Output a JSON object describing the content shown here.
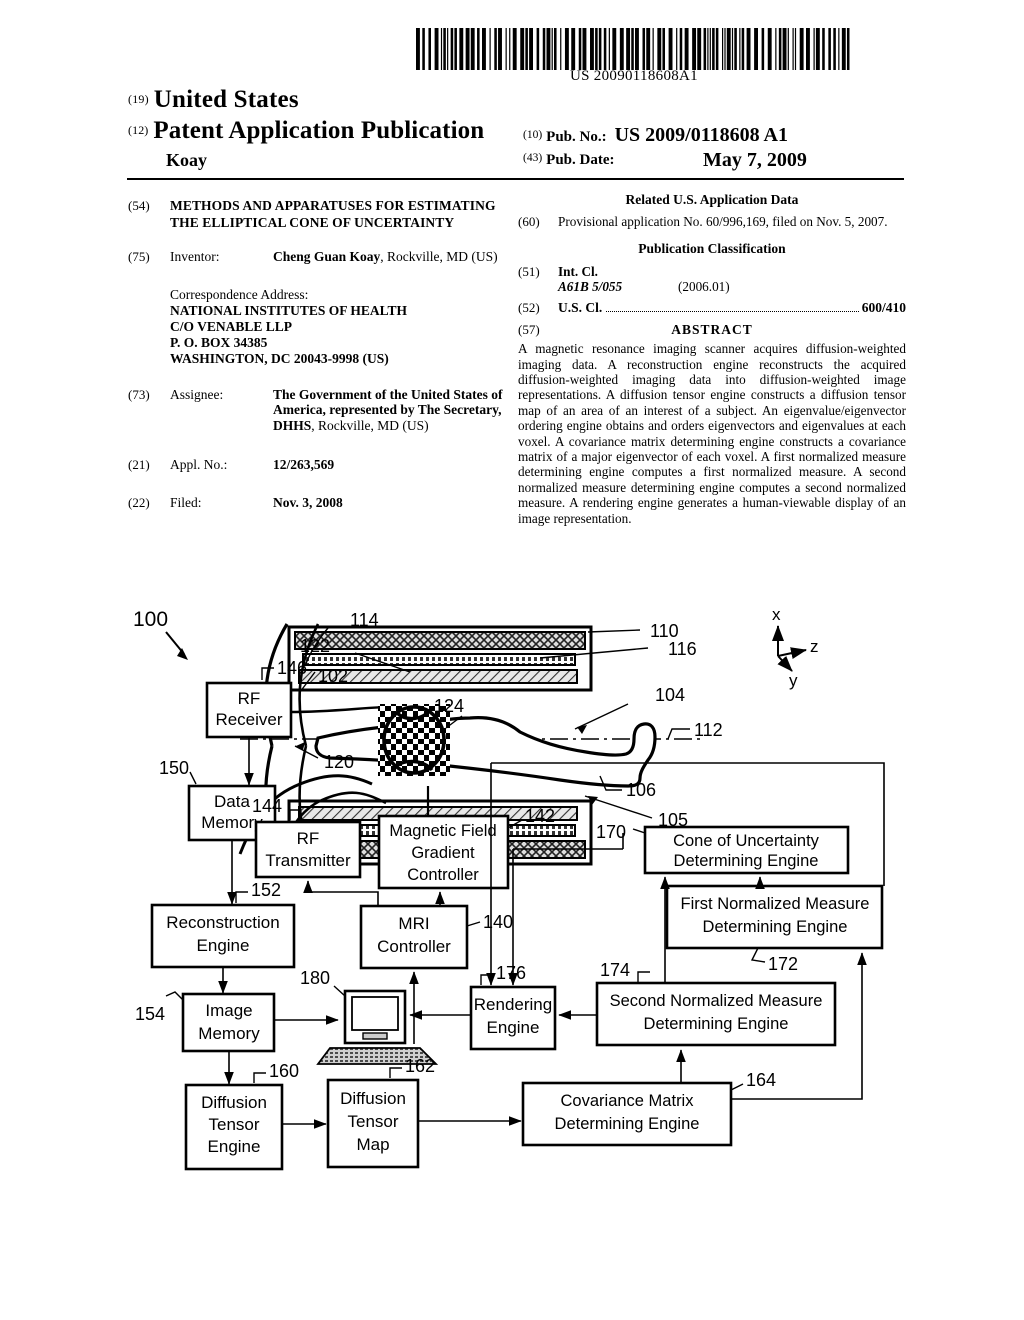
{
  "header": {
    "barcode_text": "US 20090118608A1",
    "country_code_num": "(19)",
    "country": "United States",
    "doc_type_num": "(12)",
    "doc_type": "Patent Application Publication",
    "inventor_surname": "Koay",
    "pub_no_num": "(10)",
    "pub_no_label": "Pub. No.:",
    "pub_no_value": "US 2009/0118608 A1",
    "pub_date_num": "(43)",
    "pub_date_label": "Pub. Date:",
    "pub_date_value": "May 7, 2009"
  },
  "left_column": {
    "title_num": "(54)",
    "title": "METHODS AND APPARATUSES FOR ESTIMATING THE ELLIPTICAL CONE OF UNCERTAINTY",
    "inventor_num": "(75)",
    "inventor_label": "Inventor:",
    "inventor_name": "Cheng Guan Koay",
    "inventor_location": ", Rockville, MD (US)",
    "correspondence_heading": "Correspondence Address:",
    "correspondence_lines": [
      "NATIONAL INSTITUTES OF HEALTH",
      "C/O VENABLE LLP",
      "P. O. BOX 34385",
      "WASHINGTON, DC 20043-9998 (US)"
    ],
    "assignee_num": "(73)",
    "assignee_label": "Assignee:",
    "assignee_bold": "The Government of the United States of America, represented by The Secretary, DHHS",
    "assignee_plain": ", Rockville, MD (US)",
    "appl_no_num": "(21)",
    "appl_no_label": "Appl. No.:",
    "appl_no_value": "12/263,569",
    "filed_num": "(22)",
    "filed_label": "Filed:",
    "filed_value": "Nov. 3, 2008"
  },
  "right_column": {
    "related_heading": "Related U.S. Application Data",
    "provisional_num": "(60)",
    "provisional_text": "Provisional application No. 60/996,169, filed on Nov. 5, 2007.",
    "classification_heading": "Publication Classification",
    "int_cl_num": "(51)",
    "int_cl_label": "Int. Cl.",
    "int_cl_code": "A61B 5/055",
    "int_cl_version": "(2006.01)",
    "us_cl_num": "(52)",
    "us_cl_label": "U.S. Cl.",
    "us_cl_value": "600/410",
    "abstract_num": "(57)",
    "abstract_heading": "ABSTRACT",
    "abstract_text": "A magnetic resonance imaging scanner acquires diffusion-weighted imaging data. A reconstruction engine reconstructs the acquired diffusion-weighted imaging data into diffusion-weighted image representations. A diffusion tensor engine constructs a diffusion tensor map of an area of an interest of a subject. An eigenvalue/eigenvector ordering engine obtains and orders eigenvectors and eigenvalues at each voxel. A covariance matrix determining engine constructs a covariance matrix of a major eigenvector of each voxel. A first normalized measure determining engine computes a first normalized measure. A second normalized measure determining engine computes a second normalized measure. A rendering engine generates a human-viewable display of an image representation."
  },
  "figure": {
    "system_ref": "100",
    "axes": {
      "x": "x",
      "y": "y",
      "z": "z"
    },
    "boxes": [
      {
        "id": "rf-receiver",
        "label_line1": "RF",
        "label_line2": "Receiver",
        "ref": "146"
      },
      {
        "id": "data-memory",
        "label_line1": "Data",
        "label_line2": "Memory",
        "ref": "150"
      },
      {
        "id": "rf-transmitter",
        "label_line1": "RF",
        "label_line2": "Transmitter",
        "ref": "144"
      },
      {
        "id": "magnetic-field-gradient-controller",
        "label_line1": "Magnetic Field",
        "label_line2": "Gradient",
        "label_line3": "Controller",
        "ref": "142"
      },
      {
        "id": "mri-controller",
        "label_line1": "MRI",
        "label_line2": "Controller",
        "ref": "140"
      },
      {
        "id": "reconstruction-engine",
        "label_line1": "Reconstruction",
        "label_line2": "Engine",
        "ref": "152"
      },
      {
        "id": "image-memory",
        "label_line1": "Image",
        "label_line2": "Memory",
        "ref": "154"
      },
      {
        "id": "diffusion-tensor-engine",
        "label_line1": "Diffusion",
        "label_line2": "Tensor",
        "label_line3": "Engine",
        "ref": "160"
      },
      {
        "id": "diffusion-tensor-map",
        "label_line1": "Diffusion",
        "label_line2": "Tensor",
        "label_line3": "Map",
        "ref": "162"
      },
      {
        "id": "rendering-engine",
        "label_line1": "Rendering",
        "label_line2": "Engine",
        "ref": "176"
      },
      {
        "id": "cone-of-uncertainty-determining-engine",
        "label_line1": "Cone of Uncertainty",
        "label_line2": "Determining Engine",
        "ref": "170"
      },
      {
        "id": "first-normalized-measure-determining-engine",
        "label_line1": "First Normalized Measure",
        "label_line2": "Determining Engine",
        "ref": "172"
      },
      {
        "id": "second-normalized-measure-determining-engine",
        "label_line1": "Second Normalized Measure",
        "label_line2": "Determining Engine",
        "ref": "174"
      },
      {
        "id": "covariance-matrix-determining-engine",
        "label_line1": "Covariance Matrix",
        "label_line2": "Determining Engine",
        "ref": "164"
      }
    ],
    "scanner_refs": [
      "114",
      "122",
      "102",
      "120",
      "124",
      "110",
      "116",
      "104",
      "112",
      "106",
      "105"
    ],
    "computer_ref": "180"
  }
}
